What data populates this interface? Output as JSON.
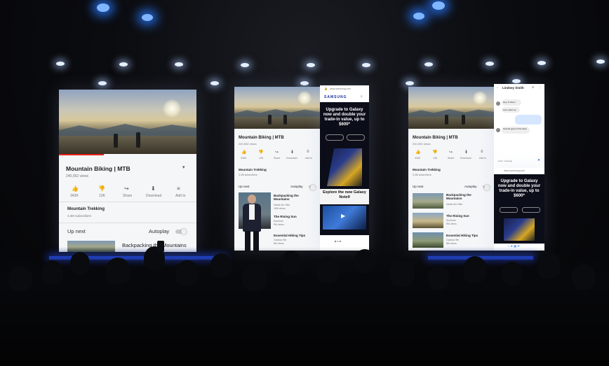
{
  "video": {
    "title": "Mountain Biking | MTB",
    "views": "240,052 views",
    "actions": {
      "like": "343K",
      "dislike": "13K",
      "share": "Share",
      "download": "Download",
      "add_to": "Add to"
    },
    "channel": "Mountain Trekking",
    "subscribers": "3.4M subscribers",
    "up_next": "Up next",
    "autoplay": "Autoplay"
  },
  "playlist": [
    {
      "title": "Backpacking the Mountains",
      "meta1": "Inside the Hike",
      "meta2": "15M views"
    },
    {
      "title": "The Rising Sun",
      "meta1": "Sunlover",
      "meta2": "9M views"
    },
    {
      "title": "Essential Hiking Tips",
      "meta1": "Outdoor life",
      "meta2": "8M views"
    }
  ],
  "browser": {
    "url": "www.samsung.com",
    "brand": "SAMSUNG",
    "promo_headline": "Upgrade to Galaxy now and double your trade-in value, up to $600*",
    "promo_sub": "Explore the new Galaxy Note9"
  },
  "messages": {
    "contact": "Lindsey Smith",
    "msg1": "Hey, hi there!",
    "msg2": "Let's catch up",
    "msg3": "Sounds good, I'll be there",
    "placeholder": "Enter message"
  },
  "colors": {
    "accent_blue": "#1a73e8",
    "stage_bar": "#2a55ff",
    "promo_bg": "#0b0d19"
  }
}
